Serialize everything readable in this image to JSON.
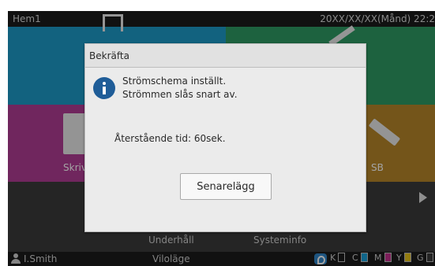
{
  "topbar": {
    "title": "Hem1",
    "datetime": "20XX/XX/XX(Månd) 22:2"
  },
  "tiles": {
    "print_label": "Skriv",
    "usb_label": "SB"
  },
  "menu": {
    "maintenance": "Underhåll",
    "sysinfo": "Systeminfo"
  },
  "dialog": {
    "title": "Bekräfta",
    "message_line1": "Strömschema inställt.",
    "message_line2": "Strömmen slås snart av.",
    "remaining": "Återstående tid: 60sek.",
    "postpone_button": "Senarelägg"
  },
  "statusbar": {
    "user": "I.Smith",
    "mode": "Viloläge",
    "inks": [
      {
        "label": "K",
        "color": "#1a1a1a"
      },
      {
        "label": "C",
        "color": "#1aa0d8"
      },
      {
        "label": "M",
        "color": "#c2318e"
      },
      {
        "label": "Y",
        "color": "#e6c21b"
      },
      {
        "label": "G",
        "color": "#3a3a3a"
      }
    ]
  },
  "colors": {
    "copy_tile": "#1d9ac7",
    "scan_tile": "#2e9a63",
    "print_tile": "#b03c93",
    "usb_tile": "#b6862a",
    "info_icon": "#1f5d98"
  },
  "icons": {
    "info": "info-icon",
    "user": "user-icon",
    "ink": "ink-drop-icon",
    "next": "chevron-right-icon"
  }
}
